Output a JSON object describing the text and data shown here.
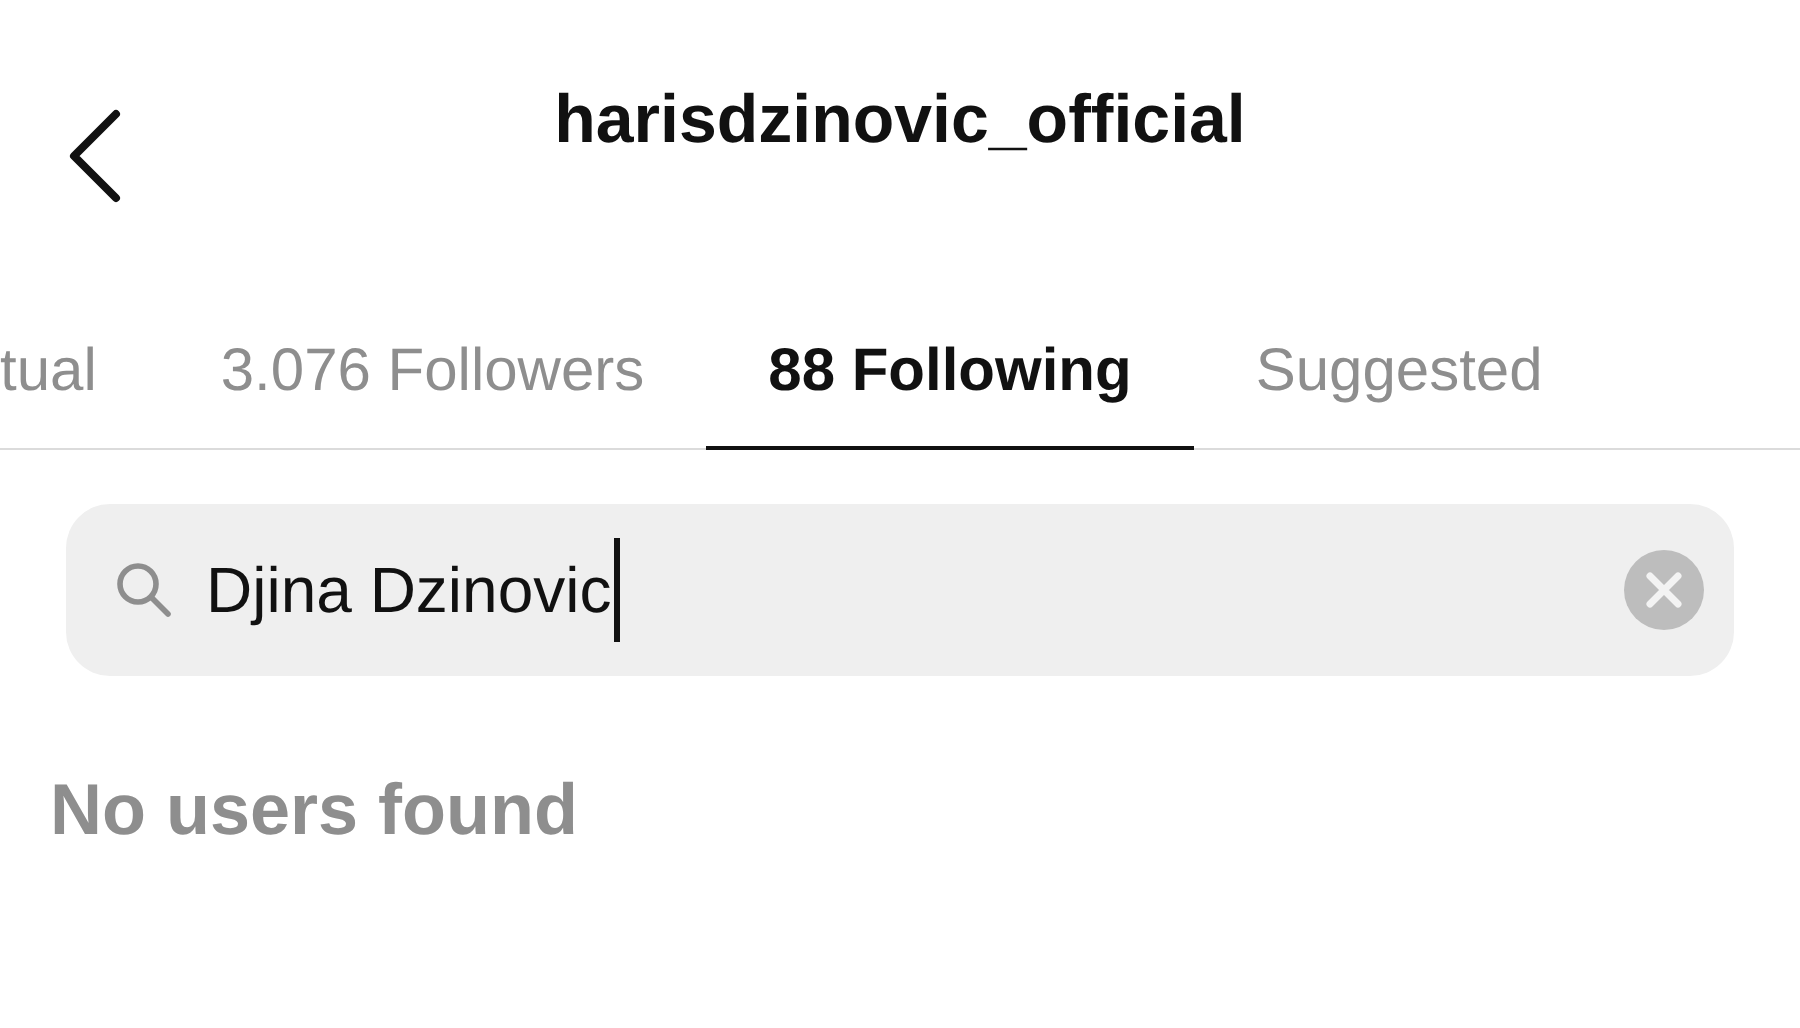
{
  "header": {
    "title": "harisdzinovic_official"
  },
  "tabs": [
    {
      "label": "tual",
      "selected": false
    },
    {
      "label": "3.076 Followers",
      "selected": false
    },
    {
      "label": "88 Following",
      "selected": true
    },
    {
      "label": "Suggested",
      "selected": false
    }
  ],
  "search": {
    "value": "Djina Dzinovic",
    "focused": true
  },
  "message": "No users found"
}
